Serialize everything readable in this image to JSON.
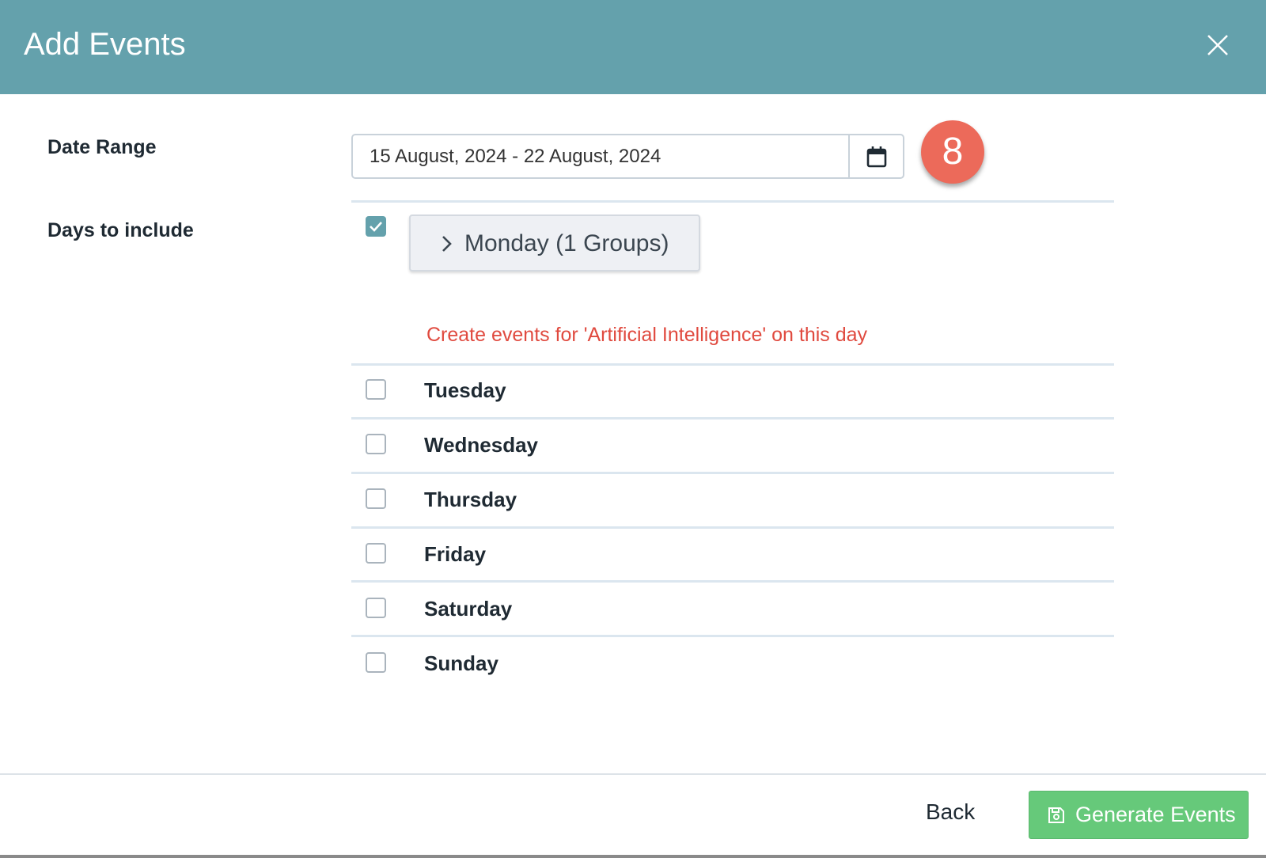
{
  "modal": {
    "title": "Add Events",
    "close_icon": "close-icon"
  },
  "form": {
    "date_range_label": "Date Range",
    "date_range_value": "15 August, 2024 - 22 August, 2024",
    "calendar_icon": "calendar-icon",
    "days_label": "Days to include"
  },
  "step_badge": "8",
  "days": [
    {
      "label": "Monday (1 Groups)",
      "checked": true,
      "expandable": true
    },
    {
      "label": "Tuesday",
      "checked": false
    },
    {
      "label": "Wednesday",
      "checked": false
    },
    {
      "label": "Thursday",
      "checked": false
    },
    {
      "label": "Friday",
      "checked": false
    },
    {
      "label": "Saturday",
      "checked": false
    },
    {
      "label": "Sunday",
      "checked": false
    }
  ],
  "warning": "Create events for 'Artificial Intelligence' on this day",
  "footer": {
    "back_label": "Back",
    "generate_label": "Generate Events",
    "generate_icon": "save-icon"
  },
  "colors": {
    "header": "#64a1ac",
    "badge": "#ec6a5a",
    "warning": "#e04a3f",
    "primary_button": "#66c97a"
  }
}
